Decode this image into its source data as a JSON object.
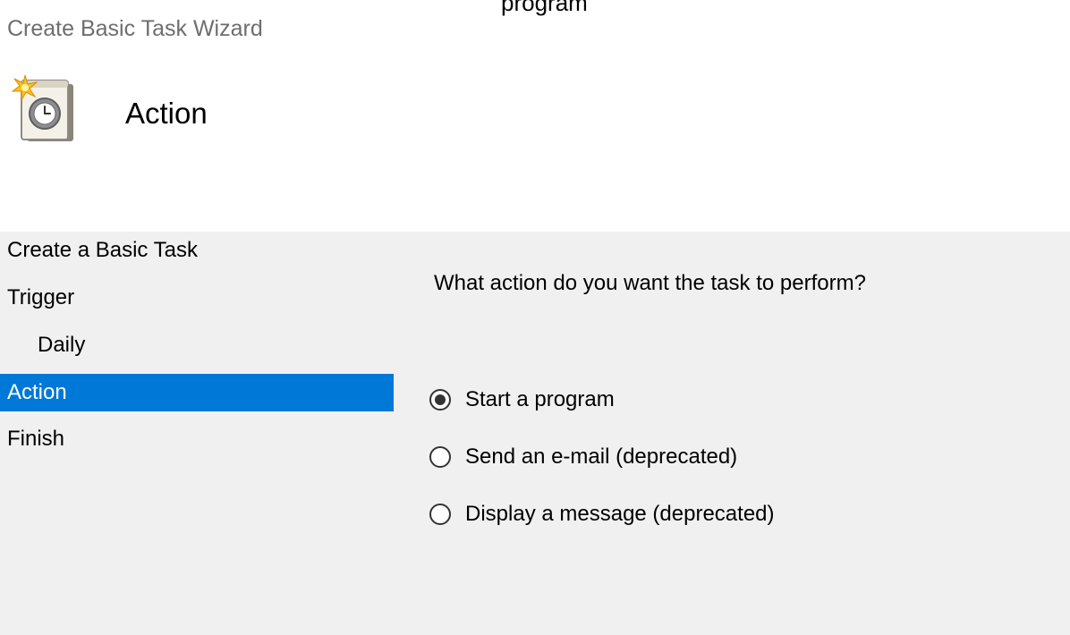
{
  "top_cut_text": "program",
  "window": {
    "title": "Create Basic Task Wizard"
  },
  "header": {
    "icon": "task-scheduler-clock-icon",
    "title": "Action"
  },
  "nav": {
    "items": [
      {
        "label": "Create a Basic Task",
        "selected": false
      },
      {
        "label": "Trigger",
        "selected": false
      },
      {
        "label": "Daily",
        "selected": false
      },
      {
        "label": "Action",
        "selected": true
      },
      {
        "label": "Finish",
        "selected": false
      }
    ]
  },
  "main": {
    "question": "What action do you want the task to perform?",
    "options": [
      {
        "label": "Start a program",
        "checked": true
      },
      {
        "label": "Send an e-mail (deprecated)",
        "checked": false
      },
      {
        "label": "Display a message (deprecated)",
        "checked": false
      }
    ]
  },
  "colors": {
    "selection": "#0078d7",
    "panel_background": "#f0f0f0",
    "title_gray": "#6e6e6e"
  }
}
